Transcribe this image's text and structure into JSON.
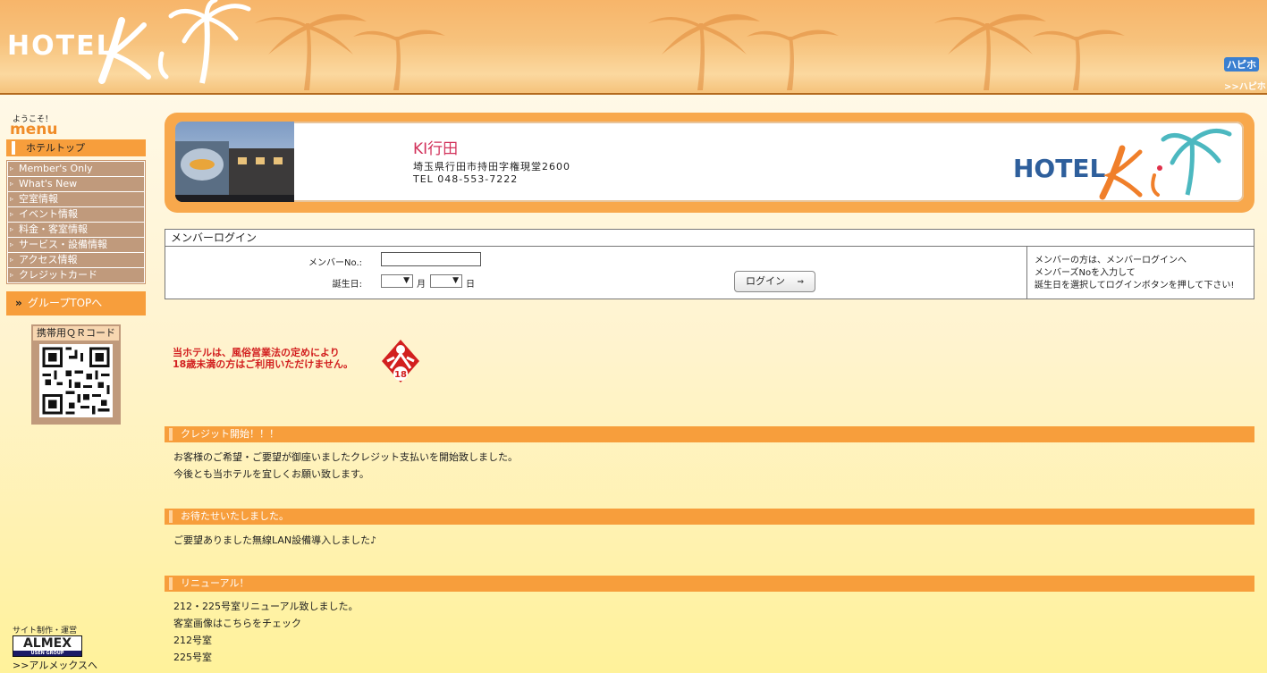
{
  "header": {
    "logo_text": "HOTEL",
    "hapi_line1": "ハピホ",
    "hapi_line2": ">>ハピホテ"
  },
  "sidebar": {
    "welcome": "ようこそ！",
    "menu_title": "menu",
    "hotel_top": "ホテルトップ",
    "items": [
      {
        "label": "Member's Only"
      },
      {
        "label": "What's New"
      },
      {
        "label": "空室情報"
      },
      {
        "label": "イベント情報"
      },
      {
        "label": "料金・客室情報"
      },
      {
        "label": "サービス・設備情報"
      },
      {
        "label": "アクセス情報"
      },
      {
        "label": "クレジットカード"
      }
    ],
    "group_top": "グループTOPへ",
    "qr_label": "携帯用ＱＲコード",
    "almex_caption": "サイト制作・運営",
    "almex_brand": "ALMEX",
    "almex_sub": "USEN GROUP",
    "almex_link": ">>アルメックスへ"
  },
  "banner": {
    "name": "KI行田",
    "address": "埼玉県行田市持田字権現堂2600",
    "tel": "TEL 048-553-7222",
    "logo_text": "HOTEL"
  },
  "login": {
    "title": "メンバーログイン",
    "member_no_label": "メンバーNo.:",
    "birthday_label": "誕生日:",
    "month_label": "月",
    "day_label": "日",
    "button": "ログイン",
    "help": [
      "メンバーの方は、メンバーログインへ",
      "メンバーズNoを入力して",
      "誕生日を選択してログインボタンを押して下さい!"
    ]
  },
  "age_notice": {
    "line1": "当ホテルは、風俗営業法の定めにより",
    "line2": "18歳未満の方はご利用いただけません。",
    "mark": "18"
  },
  "sections": [
    {
      "title": "クレジット開始！！！",
      "lines": [
        "お客様のご希望・ご要望が御座いましたクレジット支払いを開始致しました。",
        "今後とも当ホテルを宜しくお願い致します。"
      ]
    },
    {
      "title": "お待たせいたしました。",
      "lines": [
        "ご要望ありました無線LAN設備導入しました♪"
      ]
    },
    {
      "title": "リニューアル！",
      "lines": [
        "212・225号室リニューアル致しました。",
        "客室画像はこちらをチェック",
        "212号室",
        "225号室"
      ]
    }
  ],
  "colors": {
    "accent": "#f79e3c",
    "menu_item": "#c09a7c",
    "notice_red": "#d21f1f",
    "name_pink": "#d2325b"
  }
}
